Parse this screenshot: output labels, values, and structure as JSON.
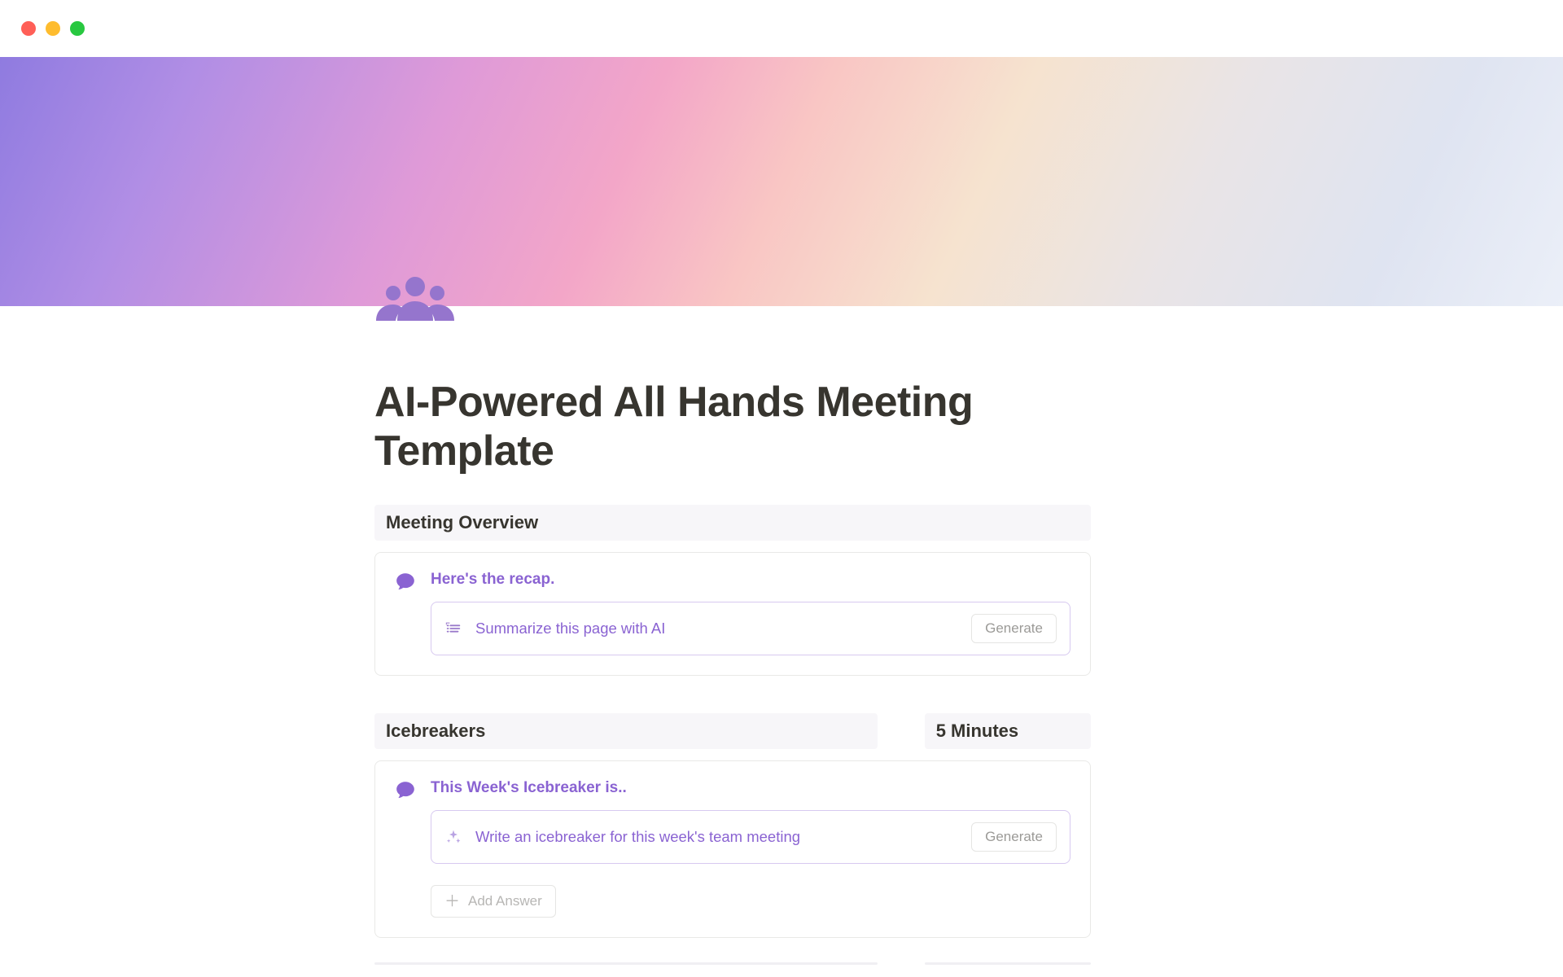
{
  "page": {
    "title": "AI-Powered All Hands Meeting Template",
    "icon": "people-icon"
  },
  "sections": {
    "overview": {
      "header": "Meeting Overview",
      "callout_title": "Here's the recap.",
      "ai_prompt": "Summarize this page with AI",
      "generate_label": "Generate"
    },
    "icebreakers": {
      "header_left": "Icebreakers",
      "header_right": "5 Minutes",
      "callout_title": "This Week's Icebreaker is..",
      "ai_prompt": "Write an icebreaker for this week's team meeting",
      "generate_label": "Generate",
      "add_answer_label": "Add Answer"
    }
  }
}
